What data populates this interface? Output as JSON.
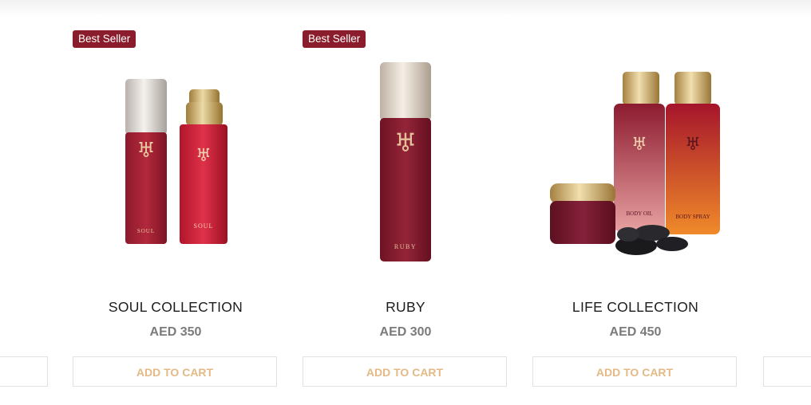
{
  "products": [
    {
      "badge": "Best Seller",
      "title": "SOUL COLLECTION",
      "price": "AED 350",
      "cart_label": "ADD TO CART"
    },
    {
      "badge": "Best Seller",
      "title": "RUBY",
      "price": "AED 300",
      "cart_label": "ADD TO CART"
    },
    {
      "title": "LIFE COLLECTION",
      "price": "AED 450",
      "cart_label": "ADD TO CART"
    }
  ],
  "colors": {
    "badge_bg": "#8a1c2b",
    "cart_text": "#e3b985",
    "price": "#7b7b7b"
  }
}
